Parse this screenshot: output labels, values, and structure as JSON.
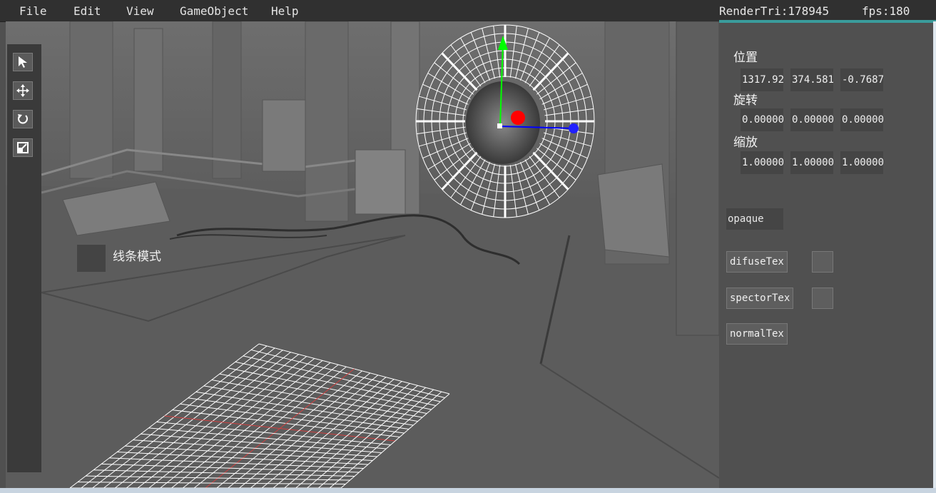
{
  "menu": {
    "file": "File",
    "edit": "Edit",
    "view": "View",
    "gameobject": "GameObject",
    "help": "Help"
  },
  "stats": {
    "render_tri": "RenderTri:178945",
    "fps": "fps:180"
  },
  "toolbar": {
    "tools": [
      "select-tool",
      "move-tool",
      "rotate-tool",
      "scale-tool"
    ]
  },
  "viewport": {
    "wireframe_label": "线条模式"
  },
  "inspector": {
    "position_label": "位置",
    "position": [
      "1317.92",
      "374.581",
      "-0.7687"
    ],
    "rotation_label": "旋转",
    "rotation": [
      "0.000000",
      "0.000000",
      "0.000000"
    ],
    "scale_label": "缩放",
    "scale": [
      "1.000000",
      "1.000000",
      "1.000000"
    ],
    "render_mode": "opaque",
    "diffuse_tex": "difuseTex",
    "specular_tex": "spectorTex",
    "normal_tex": "normalTex"
  },
  "colors": {
    "accent": "#3a9c9c",
    "menubar": "#303030",
    "panel": "#505050",
    "gizmo_x": "#0000ff",
    "gizmo_y": "#00ff00",
    "gizmo_center": "#ff0000"
  }
}
